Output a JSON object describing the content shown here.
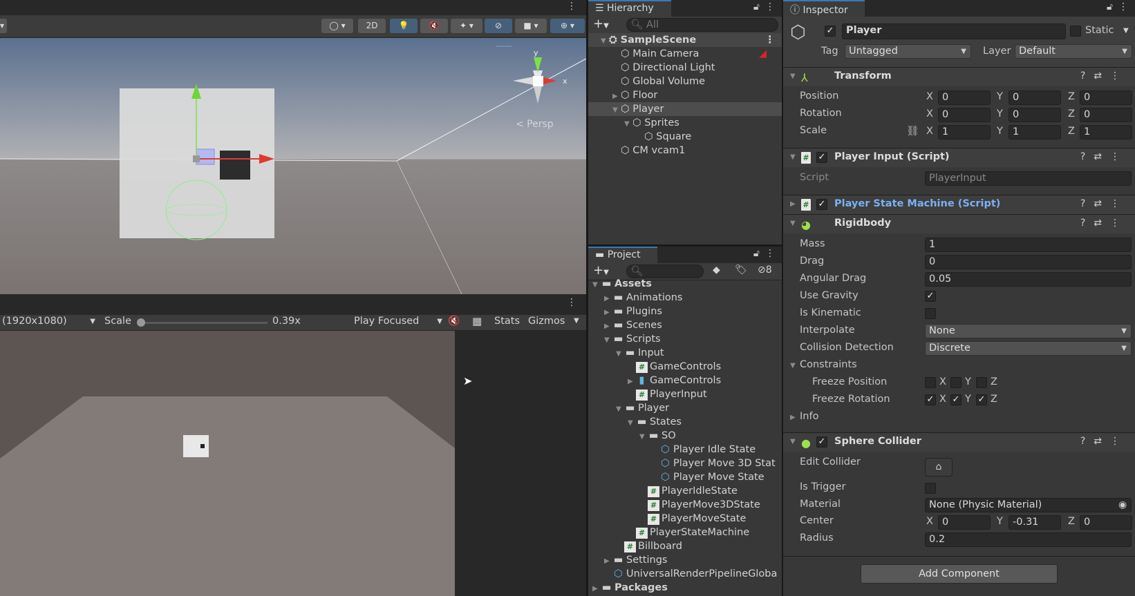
{
  "scene": {
    "persp_label": "< Persp",
    "axis_x": "x",
    "axis_y": "y",
    "toolbar_2d": "2D"
  },
  "game": {
    "resolution": "(1920x1080)",
    "scale_label": "Scale",
    "scale_value": "0.39x",
    "scale_fraction": 0.0,
    "play_mode": "Play Focused",
    "stats": "Stats",
    "gizmos": "Gizmos"
  },
  "hierarchy": {
    "title": "Hierarchy",
    "search_placeholder": "All",
    "items": [
      {
        "label": "SampleScene",
        "depth": 0,
        "expanded": true,
        "scene": true
      },
      {
        "label": "Main Camera",
        "depth": 1
      },
      {
        "label": "Directional Light",
        "depth": 1
      },
      {
        "label": "Global Volume",
        "depth": 1
      },
      {
        "label": "Floor",
        "depth": 1,
        "collapsed": true
      },
      {
        "label": "Player",
        "depth": 1,
        "expanded": true,
        "selected": true
      },
      {
        "label": "Sprites",
        "depth": 2,
        "expanded": true
      },
      {
        "label": "Square",
        "depth": 3
      },
      {
        "label": "CM vcam1",
        "depth": 1
      }
    ]
  },
  "project": {
    "title": "Project",
    "hidden_count": "8",
    "items": [
      {
        "label": "Assets",
        "depth": 0,
        "type": "folder",
        "expanded": true,
        "bold": true
      },
      {
        "label": "Animations",
        "depth": 1,
        "type": "folder",
        "collapsed": true
      },
      {
        "label": "Plugins",
        "depth": 1,
        "type": "folder",
        "collapsed": true
      },
      {
        "label": "Scenes",
        "depth": 1,
        "type": "folder",
        "collapsed": true
      },
      {
        "label": "Scripts",
        "depth": 1,
        "type": "folder",
        "expanded": true
      },
      {
        "label": "Input",
        "depth": 2,
        "type": "folder",
        "expanded": true
      },
      {
        "label": "GameControls",
        "depth": 3,
        "type": "script"
      },
      {
        "label": "GameControls",
        "depth": 3,
        "type": "input",
        "collapsed": true
      },
      {
        "label": "PlayerInput",
        "depth": 3,
        "type": "script"
      },
      {
        "label": "Player",
        "depth": 2,
        "type": "folder",
        "expanded": true
      },
      {
        "label": "States",
        "depth": 3,
        "type": "folder",
        "expanded": true
      },
      {
        "label": "SO",
        "depth": 4,
        "type": "folder",
        "expanded": true
      },
      {
        "label": "Player Idle State",
        "depth": 5,
        "type": "so"
      },
      {
        "label": "Player Move 3D Stat",
        "depth": 5,
        "type": "so"
      },
      {
        "label": "Player Move State",
        "depth": 5,
        "type": "so"
      },
      {
        "label": "PlayerIdleState",
        "depth": 4,
        "type": "script"
      },
      {
        "label": "PlayerMove3DState",
        "depth": 4,
        "type": "script"
      },
      {
        "label": "PlayerMoveState",
        "depth": 4,
        "type": "script"
      },
      {
        "label": "PlayerStateMachine",
        "depth": 3,
        "type": "script"
      },
      {
        "label": "Billboard",
        "depth": 2,
        "type": "script"
      },
      {
        "label": "Settings",
        "depth": 1,
        "type": "folder",
        "collapsed": true
      },
      {
        "label": "UniversalRenderPipelineGloba",
        "depth": 1,
        "type": "so"
      },
      {
        "label": "Packages",
        "depth": 0,
        "type": "folder",
        "collapsed": true,
        "bold": true
      }
    ]
  },
  "inspector": {
    "title": "Inspector",
    "object_name": "Player",
    "active": true,
    "static_label": "Static",
    "tag_label": "Tag",
    "tag": "Untagged",
    "layer_label": "Layer",
    "layer": "Default",
    "transform": {
      "title": "Transform",
      "position_label": "Position",
      "rotation_label": "Rotation",
      "scale_label": "Scale",
      "position": [
        "0",
        "0",
        "0"
      ],
      "rotation": [
        "0",
        "0",
        "0"
      ],
      "scale": [
        "1",
        "1",
        "1"
      ]
    },
    "player_input": {
      "title": "Player Input (Script)",
      "script_label": "Script",
      "script": "PlayerInput"
    },
    "player_state_machine": {
      "title": "Player State Machine (Script)"
    },
    "rigidbody": {
      "title": "Rigidbody",
      "mass_label": "Mass",
      "mass": "1",
      "drag_label": "Drag",
      "drag": "0",
      "angular_drag_label": "Angular Drag",
      "angular_drag": "0.05",
      "use_gravity_label": "Use Gravity",
      "use_gravity": true,
      "is_kinematic_label": "Is Kinematic",
      "is_kinematic": false,
      "interpolate_label": "Interpolate",
      "interpolate": "None",
      "collision_label": "Collision Detection",
      "collision": "Discrete",
      "constraints_label": "Constraints",
      "freeze_position_label": "Freeze Position",
      "freeze_position": [
        false,
        false,
        false
      ],
      "freeze_rotation_label": "Freeze Rotation",
      "freeze_rotation": [
        true,
        true,
        true
      ],
      "info_label": "Info"
    },
    "sphere_collider": {
      "title": "Sphere Collider",
      "edit_label": "Edit Collider",
      "trigger_label": "Is Trigger",
      "is_trigger": false,
      "material_label": "Material",
      "material": "None (Physic Material)",
      "center_label": "Center",
      "center": [
        "0",
        "-0.31",
        "0"
      ],
      "radius_label": "Radius",
      "radius": "0.2"
    },
    "add_component": "Add Component",
    "axes": [
      "X",
      "Y",
      "Z"
    ]
  },
  "colors": {
    "accent_blue": "#7bb0f0",
    "selection": "#46607c",
    "rigidbody_green": "#9ce04a"
  }
}
